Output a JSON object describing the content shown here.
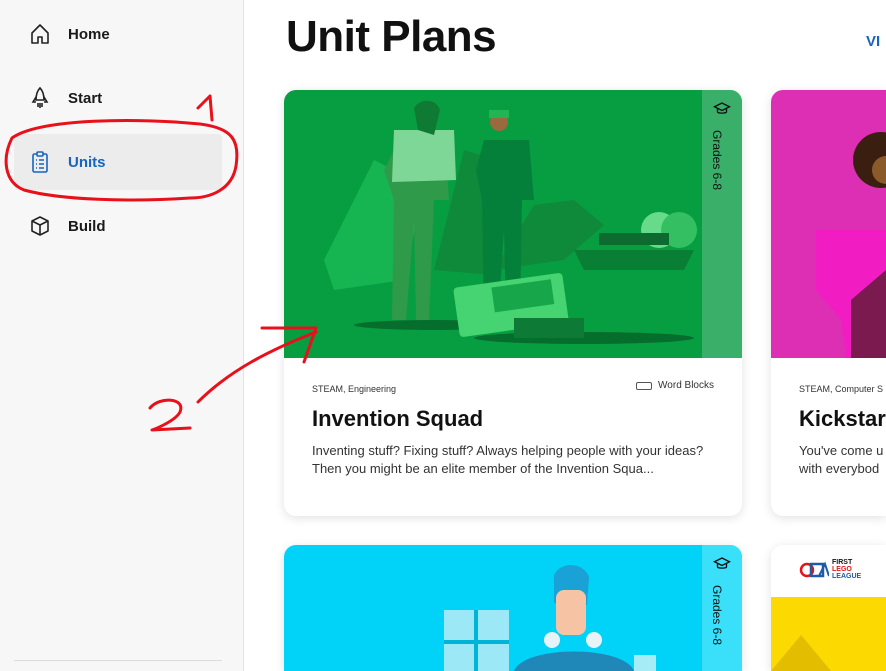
{
  "sidebar": {
    "items": [
      {
        "label": "Home",
        "icon": "home-icon"
      },
      {
        "label": "Start",
        "icon": "rocket-icon"
      },
      {
        "label": "Units",
        "icon": "clipboard-list-icon",
        "active": true
      },
      {
        "label": "Build",
        "icon": "cube-icon"
      }
    ]
  },
  "header": {
    "title": "Unit Plans",
    "view_all": "VI"
  },
  "cards": [
    {
      "grades": "Grades 6-8",
      "tags": "STEAM, Engineering",
      "code_type": "Word Blocks",
      "title": "Invention Squad",
      "description": "Inventing stuff? Fixing stuff? Always helping people with your ideas? Then you might be an elite member of the Invention Squa...",
      "art_color": "#079e42"
    },
    {
      "tags": "STEAM, Computer S",
      "title": "Kickstar",
      "description": "You've come u with everybod",
      "art_color": "#dc2fb4"
    },
    {
      "grades": "Grades 6-8",
      "art_color": "#00d3f7"
    },
    {
      "badge": [
        "FIRST",
        "LEGO",
        "LEAGUE"
      ],
      "art_color": "#fcd900"
    }
  ],
  "annotations": {
    "mark_1": "1",
    "mark_2": "2"
  },
  "colors": {
    "accent": "#1565c0",
    "annotation": "#e8101a"
  }
}
